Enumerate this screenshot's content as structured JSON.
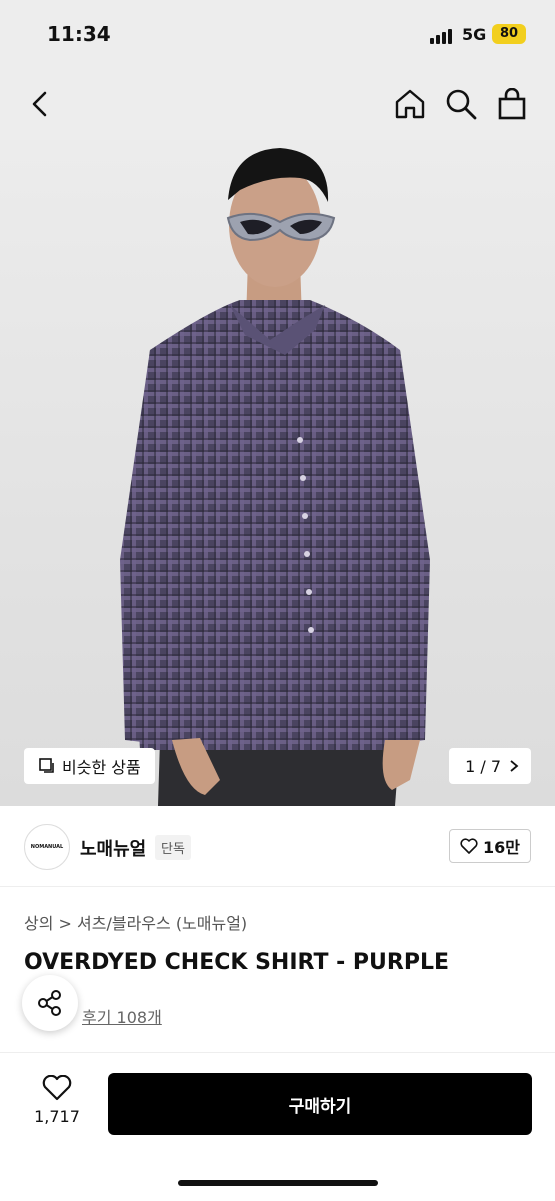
{
  "status_bar": {
    "time": "11:34",
    "network": "5G",
    "battery": "80"
  },
  "icons": {
    "back": "chevron-left-icon",
    "home": "home-icon",
    "search": "search-icon",
    "cart": "shopping-bag-icon",
    "similar": "copy-icon",
    "pager": "chevron-right-icon",
    "like": "heart-icon",
    "share": "share-icon"
  },
  "gallery": {
    "similar_label": "비슷한 상품",
    "pager": "1 / 7"
  },
  "brand": {
    "logo_text": "NOMANUAL",
    "name": "노매뉴얼",
    "badge": "단독",
    "likes": "16만"
  },
  "product": {
    "breadcrumb": "상의 > 셔츠/블라우스 (노매뉴얼)",
    "title": "OVERDYED CHECK SHIRT - PURPLE",
    "reviews": "후기 108개"
  },
  "bottom_bar": {
    "like_count": "1,717",
    "buy_label": "구매하기"
  },
  "colors": {
    "accent": "#000000",
    "battery": "#f2cf1e",
    "shirt": "#4a4460"
  }
}
